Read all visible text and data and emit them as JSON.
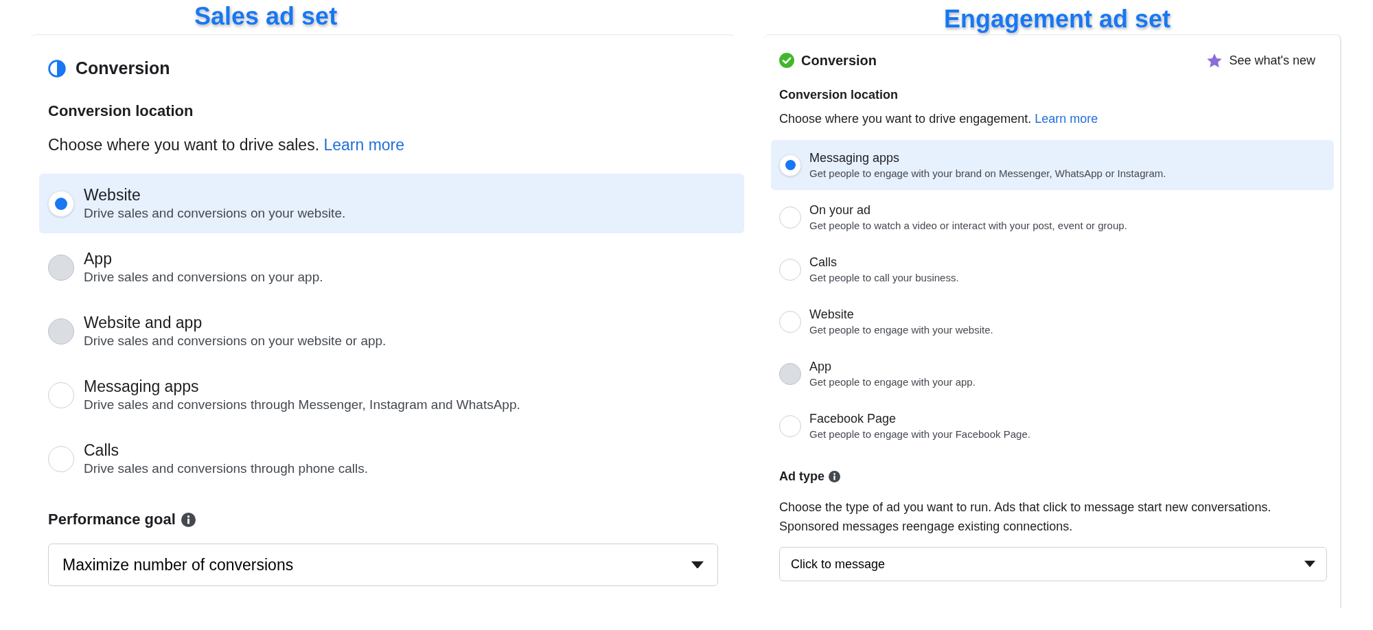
{
  "panels": [
    {
      "caption": "Sales ad set",
      "header": {
        "title": "Conversion",
        "kind": "partial"
      },
      "section": {
        "title": "Conversion location",
        "description": "Choose where you want to drive sales.",
        "link": "Learn more"
      },
      "options": [
        {
          "label": "Website",
          "description": "Drive sales and conversions on your website.",
          "selected": true,
          "disabled": false
        },
        {
          "label": "App",
          "description": "Drive sales and conversions on your app.",
          "selected": false,
          "disabled": true
        },
        {
          "label": "Website and app",
          "description": "Drive sales and conversions on your website or app.",
          "selected": false,
          "disabled": true
        },
        {
          "label": "Messaging apps",
          "description": "Drive sales and conversions through Messenger, Instagram and WhatsApp.",
          "selected": false,
          "disabled": false
        },
        {
          "label": "Calls",
          "description": "Drive sales and conversions through phone calls.",
          "selected": false,
          "disabled": false
        }
      ],
      "field": {
        "title": "Performance goal",
        "value": "Maximize number of conversions"
      }
    },
    {
      "caption": "Engagement ad set",
      "header": {
        "title": "Conversion",
        "kind": "complete",
        "link": "See what's new"
      },
      "section": {
        "title": "Conversion location",
        "description": "Choose where you want to drive engagement.",
        "link": "Learn more"
      },
      "options": [
        {
          "label": "Messaging apps",
          "description": "Get people to engage with your brand on Messenger, WhatsApp or Instagram.",
          "selected": true,
          "disabled": false
        },
        {
          "label": "On your ad",
          "description": "Get people to watch a video or interact with your post, event or group.",
          "selected": false,
          "disabled": false
        },
        {
          "label": "Calls",
          "description": "Get people to call your business.",
          "selected": false,
          "disabled": false
        },
        {
          "label": "Website",
          "description": "Get people to engage with your website.",
          "selected": false,
          "disabled": false
        },
        {
          "label": "App",
          "description": "Get people to engage with your app.",
          "selected": false,
          "disabled": true
        },
        {
          "label": "Facebook Page",
          "description": "Get people to engage with your Facebook Page.",
          "selected": false,
          "disabled": false
        }
      ],
      "field": {
        "title": "Ad type",
        "description": "Choose the type of ad you want to run. Ads that click to message start new conversations. Sponsored messages reengage existing connections.",
        "value": "Click to message"
      }
    }
  ]
}
